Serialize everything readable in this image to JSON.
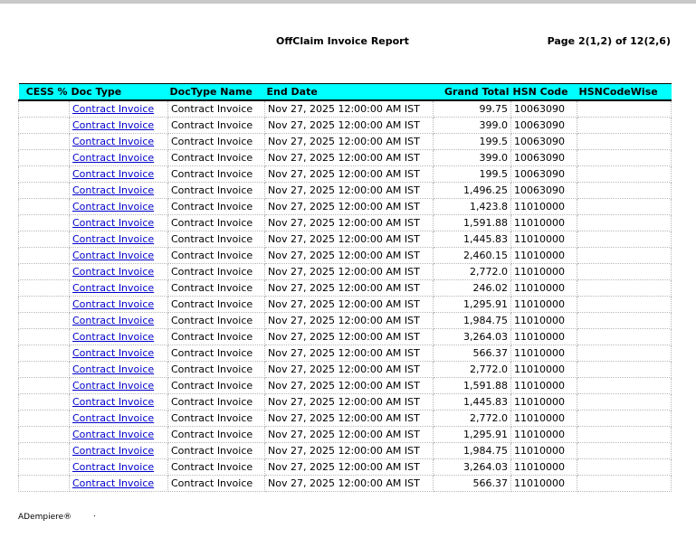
{
  "report": {
    "title": "OffClaim Invoice Report",
    "page_indicator": "Page 2(1,2) of 12(2,6)"
  },
  "columns": [
    {
      "key": "cess",
      "label": "CESS %",
      "align": "right"
    },
    {
      "key": "doc_type",
      "label": "Doc Type",
      "align": "left"
    },
    {
      "key": "doctype_name",
      "label": "DocType Name",
      "align": "left"
    },
    {
      "key": "end_date",
      "label": "End Date",
      "align": "left"
    },
    {
      "key": "grand_total",
      "label": "Grand Total",
      "align": "right"
    },
    {
      "key": "hsn_code",
      "label": "HSN Code",
      "align": "left"
    },
    {
      "key": "hsn_code_wise",
      "label": "HSNCodeWise",
      "align": "left"
    }
  ],
  "rows": [
    {
      "cess": "",
      "doc_type": "Contract Invoice",
      "doctype_name": "Contract Invoice",
      "end_date": "Nov 27, 2025 12:00:00 AM IST",
      "grand_total": "99.75",
      "hsn_code": "10063090",
      "hsn_code_wise": ""
    },
    {
      "cess": "",
      "doc_type": "Contract Invoice",
      "doctype_name": "Contract Invoice",
      "end_date": "Nov 27, 2025 12:00:00 AM IST",
      "grand_total": "399.0",
      "hsn_code": "10063090",
      "hsn_code_wise": ""
    },
    {
      "cess": "",
      "doc_type": "Contract Invoice",
      "doctype_name": "Contract Invoice",
      "end_date": "Nov 27, 2025 12:00:00 AM IST",
      "grand_total": "199.5",
      "hsn_code": "10063090",
      "hsn_code_wise": ""
    },
    {
      "cess": "",
      "doc_type": "Contract Invoice",
      "doctype_name": "Contract Invoice",
      "end_date": "Nov 27, 2025 12:00:00 AM IST",
      "grand_total": "399.0",
      "hsn_code": "10063090",
      "hsn_code_wise": ""
    },
    {
      "cess": "",
      "doc_type": "Contract Invoice",
      "doctype_name": "Contract Invoice",
      "end_date": "Nov 27, 2025 12:00:00 AM IST",
      "grand_total": "199.5",
      "hsn_code": "10063090",
      "hsn_code_wise": ""
    },
    {
      "cess": "",
      "doc_type": "Contract Invoice",
      "doctype_name": "Contract Invoice",
      "end_date": "Nov 27, 2025 12:00:00 AM IST",
      "grand_total": "1,496.25",
      "hsn_code": "10063090",
      "hsn_code_wise": ""
    },
    {
      "cess": "",
      "doc_type": "Contract Invoice",
      "doctype_name": "Contract Invoice",
      "end_date": "Nov 27, 2025 12:00:00 AM IST",
      "grand_total": "1,423.8",
      "hsn_code": "11010000",
      "hsn_code_wise": ""
    },
    {
      "cess": "",
      "doc_type": "Contract Invoice",
      "doctype_name": "Contract Invoice",
      "end_date": "Nov 27, 2025 12:00:00 AM IST",
      "grand_total": "1,591.88",
      "hsn_code": "11010000",
      "hsn_code_wise": ""
    },
    {
      "cess": "",
      "doc_type": "Contract Invoice",
      "doctype_name": "Contract Invoice",
      "end_date": "Nov 27, 2025 12:00:00 AM IST",
      "grand_total": "1,445.83",
      "hsn_code": "11010000",
      "hsn_code_wise": ""
    },
    {
      "cess": "",
      "doc_type": "Contract Invoice",
      "doctype_name": "Contract Invoice",
      "end_date": "Nov 27, 2025 12:00:00 AM IST",
      "grand_total": "2,460.15",
      "hsn_code": "11010000",
      "hsn_code_wise": ""
    },
    {
      "cess": "",
      "doc_type": "Contract Invoice",
      "doctype_name": "Contract Invoice",
      "end_date": "Nov 27, 2025 12:00:00 AM IST",
      "grand_total": "2,772.0",
      "hsn_code": "11010000",
      "hsn_code_wise": ""
    },
    {
      "cess": "",
      "doc_type": "Contract Invoice",
      "doctype_name": "Contract Invoice",
      "end_date": "Nov 27, 2025 12:00:00 AM IST",
      "grand_total": "246.02",
      "hsn_code": "11010000",
      "hsn_code_wise": ""
    },
    {
      "cess": "",
      "doc_type": "Contract Invoice",
      "doctype_name": "Contract Invoice",
      "end_date": "Nov 27, 2025 12:00:00 AM IST",
      "grand_total": "1,295.91",
      "hsn_code": "11010000",
      "hsn_code_wise": ""
    },
    {
      "cess": "",
      "doc_type": "Contract Invoice",
      "doctype_name": "Contract Invoice",
      "end_date": "Nov 27, 2025 12:00:00 AM IST",
      "grand_total": "1,984.75",
      "hsn_code": "11010000",
      "hsn_code_wise": ""
    },
    {
      "cess": "",
      "doc_type": "Contract Invoice",
      "doctype_name": "Contract Invoice",
      "end_date": "Nov 27, 2025 12:00:00 AM IST",
      "grand_total": "3,264.03",
      "hsn_code": "11010000",
      "hsn_code_wise": ""
    },
    {
      "cess": "",
      "doc_type": "Contract Invoice",
      "doctype_name": "Contract Invoice",
      "end_date": "Nov 27, 2025 12:00:00 AM IST",
      "grand_total": "566.37",
      "hsn_code": "11010000",
      "hsn_code_wise": ""
    },
    {
      "cess": "",
      "doc_type": "Contract Invoice",
      "doctype_name": "Contract Invoice",
      "end_date": "Nov 27, 2025 12:00:00 AM IST",
      "grand_total": "2,772.0",
      "hsn_code": "11010000",
      "hsn_code_wise": ""
    },
    {
      "cess": "",
      "doc_type": "Contract Invoice",
      "doctype_name": "Contract Invoice",
      "end_date": "Nov 27, 2025 12:00:00 AM IST",
      "grand_total": "1,591.88",
      "hsn_code": "11010000",
      "hsn_code_wise": ""
    },
    {
      "cess": "",
      "doc_type": "Contract Invoice",
      "doctype_name": "Contract Invoice",
      "end_date": "Nov 27, 2025 12:00:00 AM IST",
      "grand_total": "1,445.83",
      "hsn_code": "11010000",
      "hsn_code_wise": ""
    },
    {
      "cess": "",
      "doc_type": "Contract Invoice",
      "doctype_name": "Contract Invoice",
      "end_date": "Nov 27, 2025 12:00:00 AM IST",
      "grand_total": "2,772.0",
      "hsn_code": "11010000",
      "hsn_code_wise": ""
    },
    {
      "cess": "",
      "doc_type": "Contract Invoice",
      "doctype_name": "Contract Invoice",
      "end_date": "Nov 27, 2025 12:00:00 AM IST",
      "grand_total": "1,295.91",
      "hsn_code": "11010000",
      "hsn_code_wise": ""
    },
    {
      "cess": "",
      "doc_type": "Contract Invoice",
      "doctype_name": "Contract Invoice",
      "end_date": "Nov 27, 2025 12:00:00 AM IST",
      "grand_total": "1,984.75",
      "hsn_code": "11010000",
      "hsn_code_wise": ""
    },
    {
      "cess": "",
      "doc_type": "Contract Invoice",
      "doctype_name": "Contract Invoice",
      "end_date": "Nov 27, 2025 12:00:00 AM IST",
      "grand_total": "3,264.03",
      "hsn_code": "11010000",
      "hsn_code_wise": ""
    },
    {
      "cess": "",
      "doc_type": "Contract Invoice",
      "doctype_name": "Contract Invoice",
      "end_date": "Nov 27, 2025 12:00:00 AM IST",
      "grand_total": "566.37",
      "hsn_code": "11010000",
      "hsn_code_wise": ""
    }
  ],
  "footer": {
    "brand": "ADempiere®",
    "mark": "."
  },
  "colors": {
    "header_background": "#00ffff",
    "link": "#0000cc",
    "top_bar": "#c8c8c8"
  }
}
